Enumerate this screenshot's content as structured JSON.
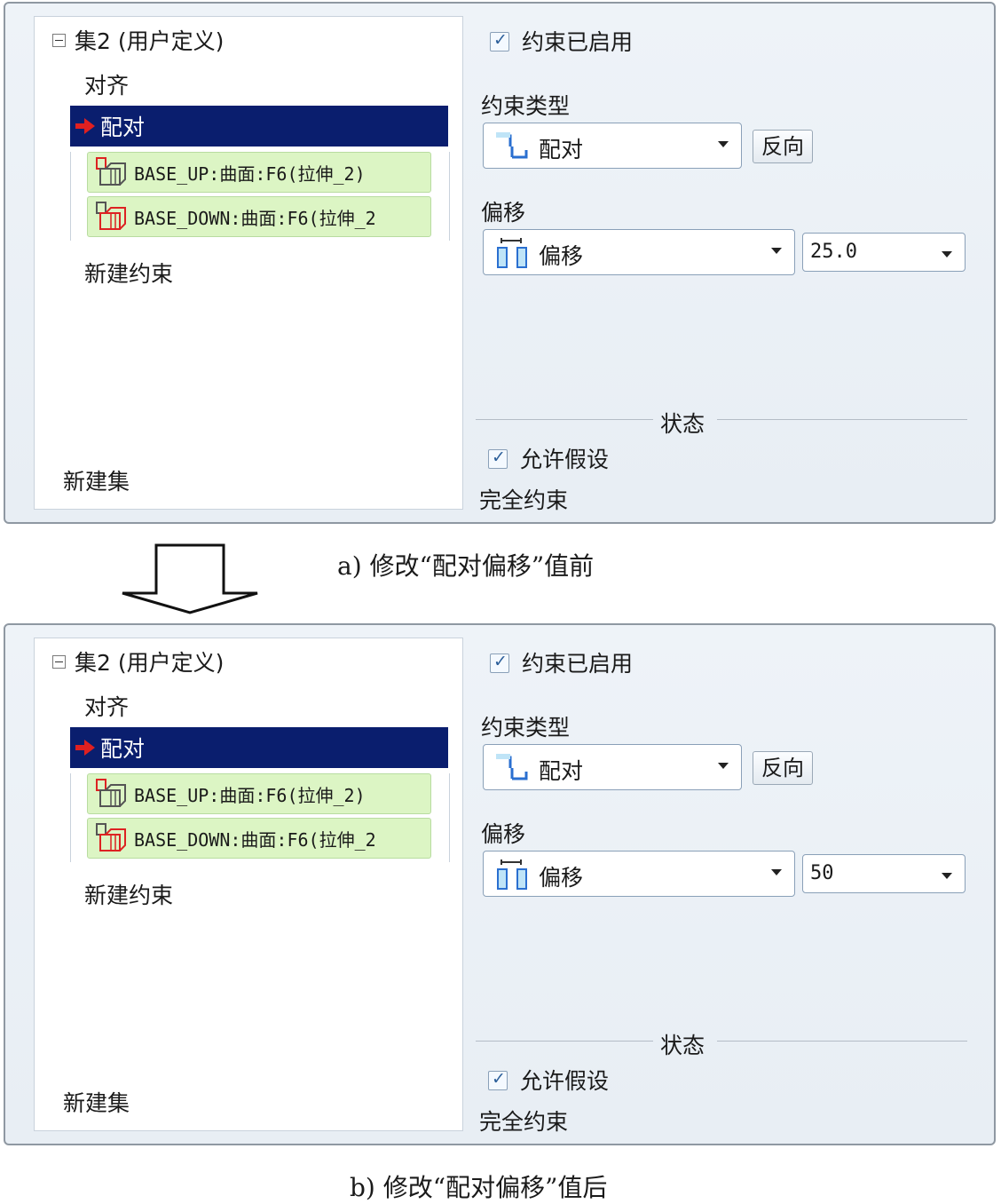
{
  "panels": [
    {
      "tree": {
        "root": "集2 (用户定义)",
        "items": {
          "align": "对齐",
          "mate": "配对",
          "new_constraint": "新建约束"
        },
        "refs": [
          "BASE_UP:曲面:F6(拉伸_2)",
          "BASE_DOWN:曲面:F6(拉伸_2"
        ],
        "new_set": "新建集"
      },
      "props": {
        "enabled_label": "约束已启用",
        "type_label": "约束类型",
        "type_value": "配对",
        "flip_label": "反向",
        "offset_label": "偏移",
        "offset_type": "偏移",
        "offset_value": "25.0",
        "status_title": "状态",
        "assume_label": "允许假设",
        "status_text": "完全约束"
      },
      "caption": "a) 修改“配对偏移”值前"
    },
    {
      "tree": {
        "root": "集2 (用户定义)",
        "items": {
          "align": "对齐",
          "mate": "配对",
          "new_constraint": "新建约束"
        },
        "refs": [
          "BASE_UP:曲面:F6(拉伸_2)",
          "BASE_DOWN:曲面:F6(拉伸_2"
        ],
        "new_set": "新建集"
      },
      "props": {
        "enabled_label": "约束已启用",
        "type_label": "约束类型",
        "type_value": "配对",
        "flip_label": "反向",
        "offset_label": "偏移",
        "offset_type": "偏移",
        "offset_value": "50",
        "status_title": "状态",
        "assume_label": "允许假设",
        "status_text": "完全约束"
      },
      "caption": "b) 修改“配对偏移”值后"
    }
  ],
  "icons": {
    "collapse": "minus-box-icon",
    "active": "red-arrow-icon",
    "surface_ref": "surface-ref-icon",
    "mate_type": "mate-constraint-icon",
    "offset_type": "offset-icon",
    "transition": "down-arrow-icon"
  },
  "colors": {
    "selected_row": "#0a1e6e",
    "ref_highlight": "#dcf5c4",
    "panel_bg": "#eef3f8",
    "active_arrow": "#e02020"
  }
}
